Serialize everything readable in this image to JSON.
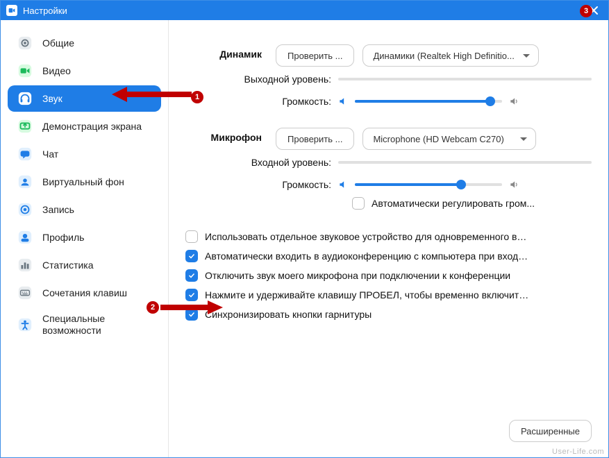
{
  "titlebar": {
    "title": "Настройки"
  },
  "sidebar": {
    "items": [
      {
        "label": "Общие"
      },
      {
        "label": "Видео"
      },
      {
        "label": "Звук"
      },
      {
        "label": "Демонстрация экрана"
      },
      {
        "label": "Чат"
      },
      {
        "label": "Виртуальный фон"
      },
      {
        "label": "Запись"
      },
      {
        "label": "Профиль"
      },
      {
        "label": "Статистика"
      },
      {
        "label": "Сочетания клавиш"
      },
      {
        "label": "Специальные возможности"
      }
    ],
    "activeIndex": 2
  },
  "speaker": {
    "heading": "Динамик",
    "testButton": "Проверить ...",
    "device": "Динамики (Realtek High Definitio...",
    "outputLevelLabel": "Выходной уровень:",
    "volumeLabel": "Громкость:",
    "volumePercent": 92
  },
  "microphone": {
    "heading": "Микрофон",
    "testButton": "Проверить ...",
    "device": "Microphone (HD Webcam C270)",
    "inputLevelLabel": "Входной уровень:",
    "volumeLabel": "Громкость:",
    "volumePercent": 72,
    "autoAdjust": {
      "checked": false,
      "label": "Автоматически регулировать гром..."
    }
  },
  "options": [
    {
      "checked": false,
      "label": "Использовать отдельное звуковое устройство для одновременного воспро..."
    },
    {
      "checked": true,
      "label": "Автоматически входить в аудиоконференцию с компьютера при входе в кон..."
    },
    {
      "checked": true,
      "label": "Отключить звук моего микрофона при подключении к конференции"
    },
    {
      "checked": true,
      "label": "Нажмите и удерживайте клавишу ПРОБЕЛ, чтобы временно включить свой з..."
    },
    {
      "checked": true,
      "label": "Синхронизировать кнопки гарнитуры"
    }
  ],
  "advancedButton": "Расширенные",
  "annotations": {
    "b1": "1",
    "b2": "2",
    "b3": "3"
  },
  "watermark": "User-Life.com"
}
